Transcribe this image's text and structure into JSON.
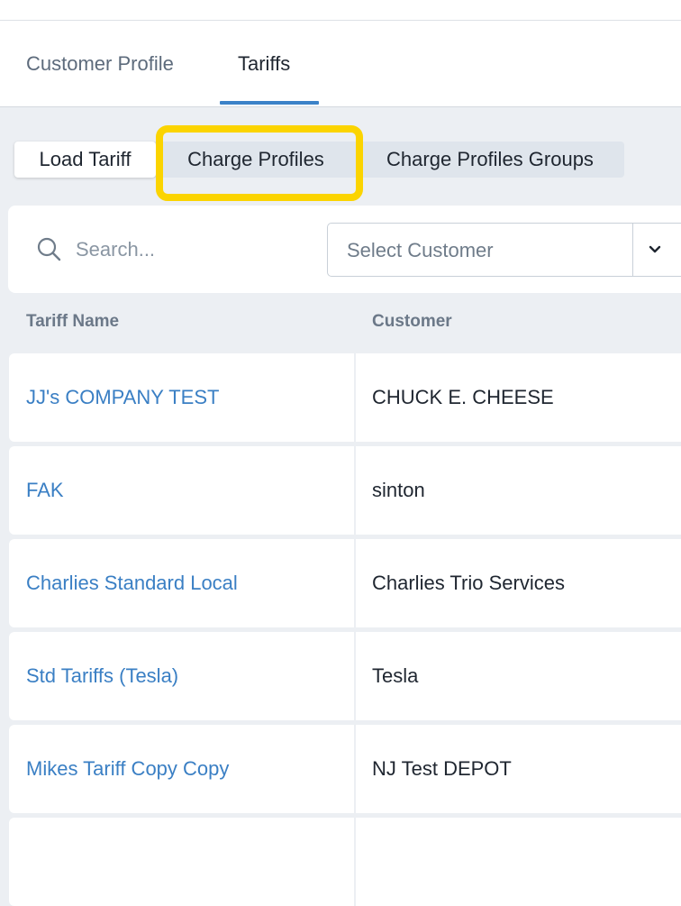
{
  "tabs": {
    "customer_profile": "Customer Profile",
    "tariffs": "Tariffs"
  },
  "subtabs": {
    "load_tariff": "Load Tariff",
    "charge_profiles": "Charge Profiles",
    "charge_profiles_groups": "Charge Profiles Groups"
  },
  "filters": {
    "search_placeholder": "Search...",
    "select_customer": "Select Customer"
  },
  "table": {
    "headers": {
      "tariff_name": "Tariff Name",
      "customer": "Customer"
    },
    "rows": [
      {
        "tariff_name": "JJ's COMPANY TEST",
        "customer": "CHUCK E. CHEESE"
      },
      {
        "tariff_name": "FAK",
        "customer": "sinton"
      },
      {
        "tariff_name": "Charlies Standard Local",
        "customer": "Charlies Trio Services"
      },
      {
        "tariff_name": "Std Tariffs (Tesla)",
        "customer": "Tesla"
      },
      {
        "tariff_name": "Mikes Tariff Copy Copy",
        "customer": "NJ Test DEPOT"
      },
      {
        "tariff_name": "",
        "customer": ""
      }
    ]
  },
  "colors": {
    "accent": "#3b82c8",
    "link": "#3a7fc4",
    "highlight": "#fbd400",
    "background": "#eceff3"
  },
  "icons": {
    "search": "search-icon",
    "dropdown": "chevron-down-icon"
  }
}
